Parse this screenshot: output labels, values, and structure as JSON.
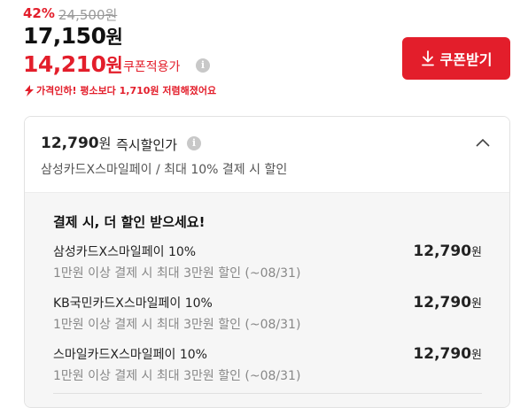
{
  "price": {
    "discount_rate": "42%",
    "original_price": "24,500원",
    "sale_price": "17,150",
    "sale_unit": "원",
    "coupon_price": "14,210",
    "coupon_unit": "원",
    "coupon_label": "쿠폰적용가",
    "drop_note": "가격인하! 평소보다 1,710원 저렴해졌어요"
  },
  "coupon_button": {
    "label": "쿠폰받기"
  },
  "instant_discount": {
    "price": "12,790",
    "unit": "원",
    "label": "즉시할인가",
    "description": "삼성카드X스마일페이 / 최대 10% 결제 시 할인",
    "expanded": true
  },
  "benefits": {
    "title": "결제 시, 더 할인 받으세요!",
    "items": [
      {
        "name": "삼성카드X스마일페이 10%",
        "condition": "1만원 이상 결제 시 최대 3만원 할인 (~08/31)",
        "price": "12,790",
        "unit": "원"
      },
      {
        "name": "KB국민카드X스마일페이 10%",
        "condition": "1만원 이상 결제 시 최대 3만원 할인 (~08/31)",
        "price": "12,790",
        "unit": "원"
      },
      {
        "name": "스마일카드X스마일페이 10%",
        "condition": "1만원 이상 결제 시 최대 3만원 할인 (~08/31)",
        "price": "12,790",
        "unit": "원"
      }
    ]
  },
  "colors": {
    "accent": "#e31e2b",
    "muted": "#9a9a9a",
    "panel_bg": "#f6f6f6"
  },
  "icons": [
    "info-icon",
    "download-icon",
    "lightning-icon",
    "chevron-up-icon"
  ]
}
